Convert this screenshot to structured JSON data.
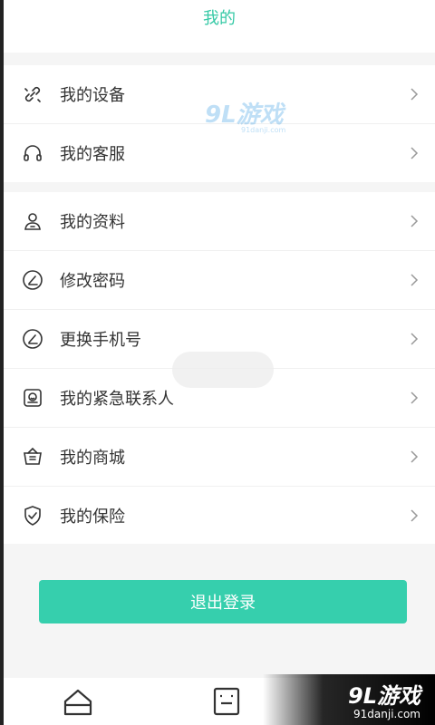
{
  "header": {
    "title": "我的"
  },
  "groups": [
    {
      "items": [
        {
          "label": "我的设备",
          "icon": "link-icon"
        },
        {
          "label": "我的客服",
          "icon": "headset-icon"
        }
      ]
    },
    {
      "items": [
        {
          "label": "我的资料",
          "icon": "user-profile-icon"
        },
        {
          "label": "修改密码",
          "icon": "edit-circle-icon"
        },
        {
          "label": "更换手机号",
          "icon": "edit-circle-icon"
        },
        {
          "label": "我的紧急联系人",
          "icon": "emergency-contact-icon"
        },
        {
          "label": "我的商城",
          "icon": "basket-icon"
        },
        {
          "label": "我的保险",
          "icon": "shield-check-icon"
        }
      ]
    }
  ],
  "logout": {
    "label": "退出登录"
  },
  "watermark": {
    "brand": "9L游戏",
    "domain": "91danji.com"
  },
  "colors": {
    "accent": "#36cfad",
    "title": "#36c9a6"
  }
}
